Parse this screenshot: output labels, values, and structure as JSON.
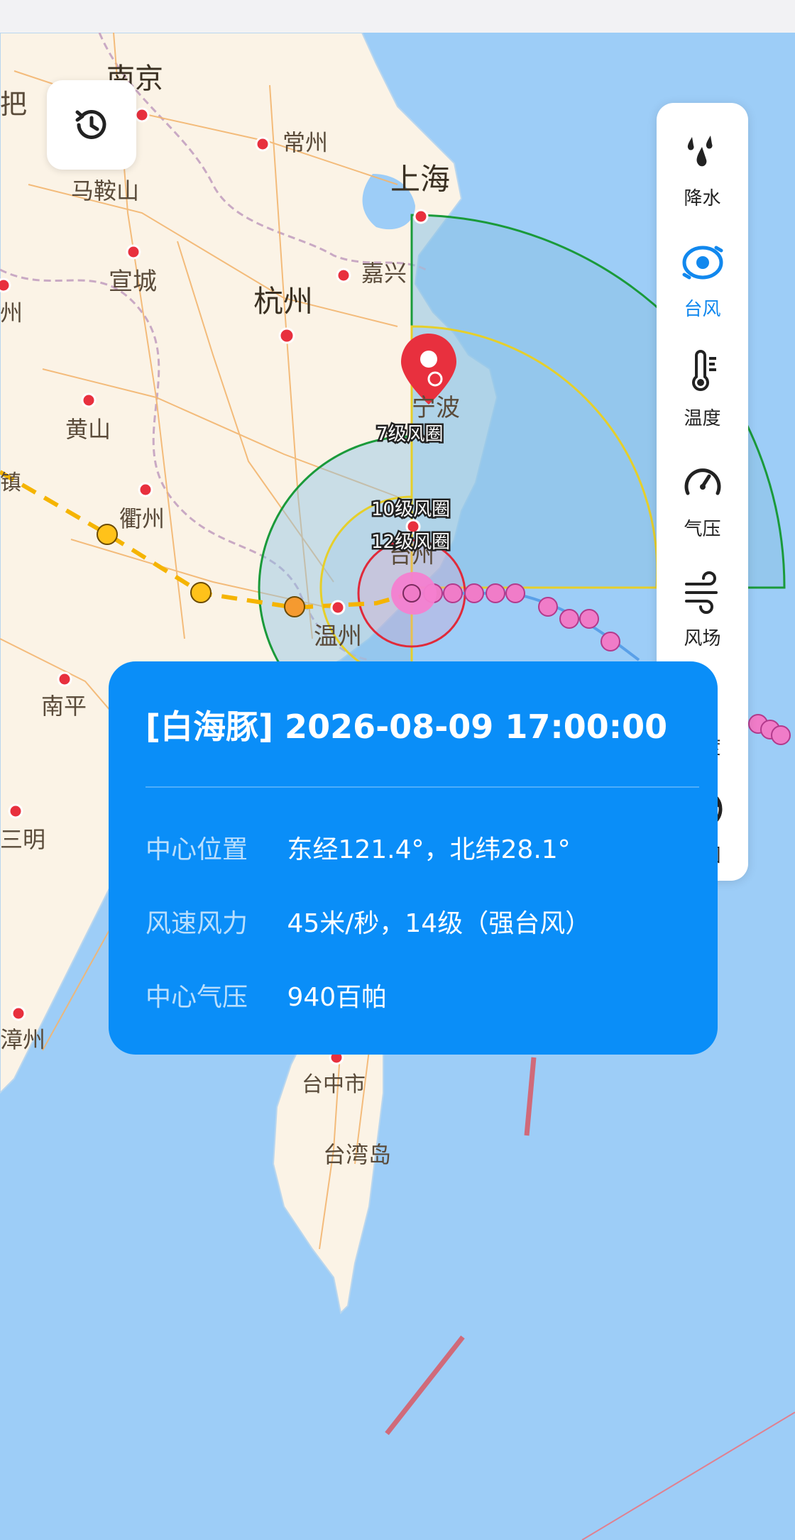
{
  "map": {
    "cities": [
      {
        "name": "南京"
      },
      {
        "name": "常州"
      },
      {
        "name": "马鞍山"
      },
      {
        "name": "上海"
      },
      {
        "name": "宣城"
      },
      {
        "name": "嘉兴"
      },
      {
        "name": "杭州"
      },
      {
        "name": "州"
      },
      {
        "name": "宁波"
      },
      {
        "name": "黄山"
      },
      {
        "name": "衢州"
      },
      {
        "name": "台州"
      },
      {
        "name": "温州"
      },
      {
        "name": "南平"
      },
      {
        "name": "三明"
      },
      {
        "name": "漳州"
      },
      {
        "name": "台中市"
      },
      {
        "name": "台湾岛"
      },
      {
        "name": "把"
      },
      {
        "name": "镇"
      }
    ],
    "wind_circles": [
      {
        "label": "7级风圈",
        "color": "#1a9a3a"
      },
      {
        "label": "10级风圈",
        "color": "#e6cf2a"
      },
      {
        "label": "12级风圈",
        "color": "#e02a3a"
      }
    ]
  },
  "side_panel": {
    "items": [
      {
        "label": "降水",
        "icon": "rain-drops-icon",
        "active": false
      },
      {
        "label": "台风",
        "icon": "typhoon-icon",
        "active": true
      },
      {
        "label": "温度",
        "icon": "thermometer-icon",
        "active": false
      },
      {
        "label": "气压",
        "icon": "gauge-icon",
        "active": false
      },
      {
        "label": "风场",
        "icon": "wind-icon",
        "active": false
      },
      {
        "label": "湿度",
        "icon": "humidity-drop-icon",
        "active": false
      },
      {
        "label": "云图",
        "icon": "globe-icon",
        "active": false
      }
    ],
    "active_color": "#1188ee"
  },
  "info_card": {
    "title": "[白海豚] 2026-08-09 17:00:00",
    "rows": [
      {
        "key": "中心位置",
        "value": "东经121.4°，北纬28.1°"
      },
      {
        "key": "风速风力",
        "value": "45米/秒，14级（强台风）"
      },
      {
        "key": "中心气压",
        "value": "940百帕"
      }
    ],
    "bg_color": "#0a8ef8"
  },
  "history_button": {
    "icon": "history-icon"
  }
}
